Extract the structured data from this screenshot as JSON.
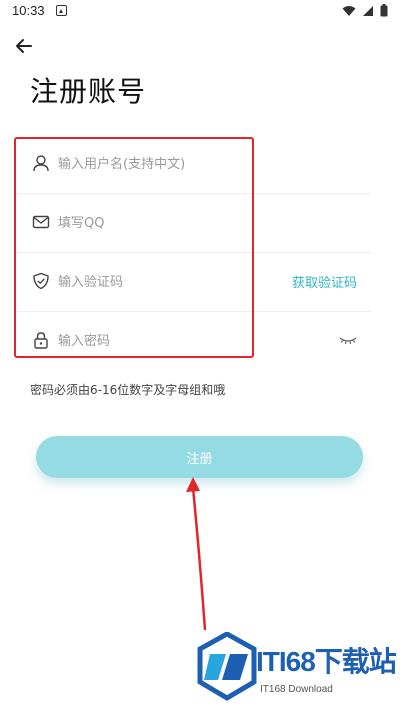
{
  "status_bar": {
    "time": "10:33"
  },
  "header": {
    "title": "注册账号"
  },
  "form": {
    "username": {
      "placeholder": "输入用户名(支持中文)",
      "icon": "user-icon"
    },
    "qq": {
      "placeholder": "填写QQ",
      "icon": "mail-icon"
    },
    "code": {
      "placeholder": "输入验证码",
      "icon": "shield-icon",
      "get_code": "获取验证码"
    },
    "password": {
      "placeholder": "输入密码",
      "icon": "lock-icon"
    }
  },
  "hint": "密码必须由6-16位数字及字母组和哦",
  "register_button": "注册",
  "colors": {
    "accent": "#2db7c6",
    "button": "#95dbe3",
    "highlight": "#e0262a"
  },
  "watermark": {
    "text": "ITI68下载站",
    "sub": "IT168 Download"
  }
}
